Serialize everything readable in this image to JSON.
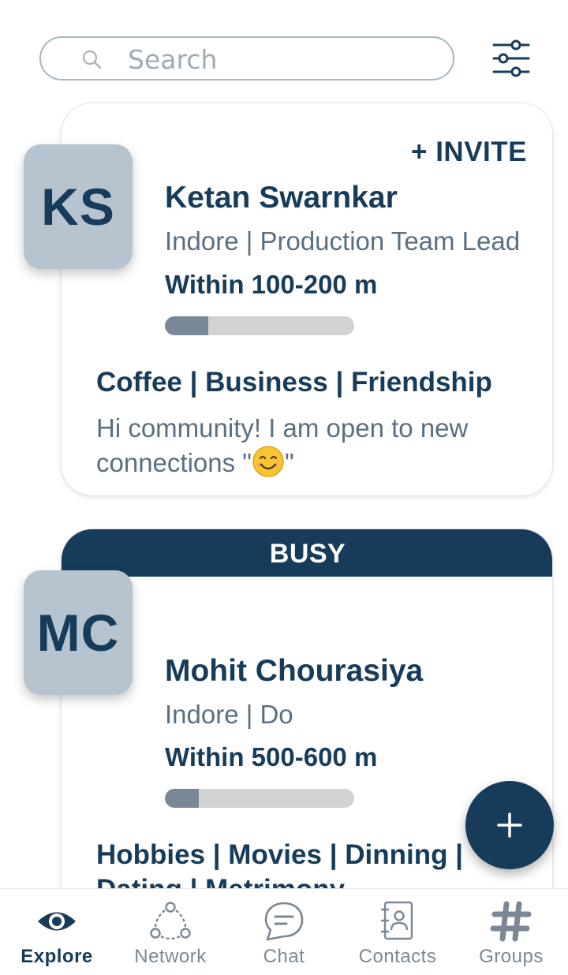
{
  "search": {
    "placeholder": "Search",
    "value": ""
  },
  "filter": {
    "icon": "sliders-icon"
  },
  "cards": [
    {
      "initials": "KS",
      "invite_label": "+ INVITE",
      "name": "Ketan Swarnkar",
      "subtitle": "Indore | Production Team Lead",
      "distance": "Within 100-200 m",
      "proximity": 0.23,
      "tags": "Coffee | Business | Friendship",
      "about_text": "Hi community! I am open to new connections \"",
      "about_emoji": "smiling-face-emoji",
      "about_end": "\""
    },
    {
      "initials": "MC",
      "status": "BUSY",
      "name": "Mohit Chourasiya",
      "subtitle": "Indore | Do",
      "distance": "Within 500-600 m",
      "proximity": 0.18,
      "tags": "Hobbies | Movies | Dinning |",
      "tags_line2": "Dating | Metrimony"
    }
  ],
  "fab": {
    "icon": "plus-icon"
  },
  "nav": {
    "items": [
      {
        "label": "Explore",
        "icon": "eye-icon",
        "active": true
      },
      {
        "label": "Network",
        "icon": "network-icon",
        "active": false
      },
      {
        "label": "Chat",
        "icon": "chat-icon",
        "active": false
      },
      {
        "label": "Contacts",
        "icon": "contacts-icon",
        "active": false
      },
      {
        "label": "Groups",
        "icon": "hashtag-icon",
        "active": false
      }
    ]
  },
  "colors": {
    "primary": "#173c5a",
    "avatar_bg": "#b6c4cf",
    "text_muted": "#5b6f80",
    "progress_fill": "#788896",
    "progress_track": "#d2d2d2"
  }
}
